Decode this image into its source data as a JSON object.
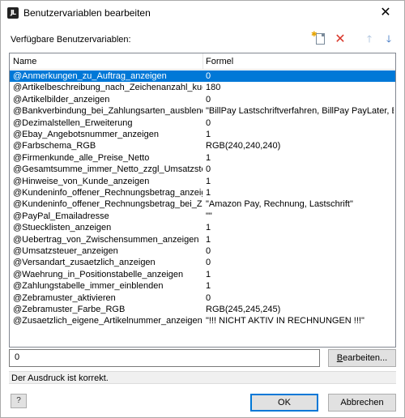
{
  "window": {
    "title": "Benutzervariablen bearbeiten",
    "app_icon_text": "JL",
    "close_glyph": "✕"
  },
  "toolbar": {
    "label": "Verfügbare Benutzervariablen:",
    "icons": [
      "new-variable-icon",
      "delete-icon",
      "move-up-icon",
      "move-down-icon"
    ]
  },
  "table": {
    "headers": {
      "name": "Name",
      "formula": "Formel"
    },
    "selected_index": 0,
    "rows": [
      {
        "name": "@Anmerkungen_zu_Auftrag_anzeigen",
        "formula": "0"
      },
      {
        "name": "@Artikelbeschreibung_nach_Zeichenanzahl_kuerzen",
        "formula": "180"
      },
      {
        "name": "@Artikelbilder_anzeigen",
        "formula": "0"
      },
      {
        "name": "@Bankverbindung_bei_Zahlungsarten_ausblenden",
        "formula": "\"BillPay Lastschriftverfahren, BillPay PayLater, BillPay F"
      },
      {
        "name": "@Dezimalstellen_Erweiterung",
        "formula": "0"
      },
      {
        "name": "@Ebay_Angebotsnummer_anzeigen",
        "formula": "1"
      },
      {
        "name": "@Farbschema_RGB",
        "formula": "RGB(240,240,240)"
      },
      {
        "name": "@Firmenkunde_alle_Preise_Netto",
        "formula": "1"
      },
      {
        "name": "@Gesamtsumme_immer_Netto_zzgl_Umsatzsteuer",
        "formula": "0"
      },
      {
        "name": "@Hinweise_von_Kunde_anzeigen",
        "formula": "1"
      },
      {
        "name": "@Kundeninfo_offener_Rechnungsbetrag_anzeigen",
        "formula": "1"
      },
      {
        "name": "@Kundeninfo_offener_Rechnungsbetrag_bei_Zahlungs",
        "formula": "\"Amazon Pay, Rechnung, Lastschrift\""
      },
      {
        "name": "@PayPal_Emailadresse",
        "formula": "\"\""
      },
      {
        "name": "@Stuecklisten_anzeigen",
        "formula": "1"
      },
      {
        "name": "@Uebertrag_von_Zwischensummen_anzeigen",
        "formula": "1"
      },
      {
        "name": "@Umsatzsteuer_anzeigen",
        "formula": "0"
      },
      {
        "name": "@Versandart_zusaetzlich_anzeigen",
        "formula": "0"
      },
      {
        "name": "@Waehrung_in_Positionstabelle_anzeigen",
        "formula": "1"
      },
      {
        "name": "@Zahlungstabelle_immer_einblenden",
        "formula": "1"
      },
      {
        "name": "@Zebramuster_aktivieren",
        "formula": "0"
      },
      {
        "name": "@Zebramuster_Farbe_RGB",
        "formula": "RGB(245,245,245)"
      },
      {
        "name": "@Zusaetzlich_eigene_Artikelnummer_anzeigen",
        "formula": "\"!!! NICHT AKTIV IN RECHNUNGEN !!!\""
      }
    ]
  },
  "expression": {
    "value": "0",
    "edit_button": "Bearbeiten..."
  },
  "status": {
    "text": "Der Ausdruck ist korrekt."
  },
  "footer": {
    "help_glyph": "?",
    "ok": "OK",
    "cancel": "Abbrechen"
  },
  "colors": {
    "selection": "#0078d7",
    "delete_icon": "#d9372a",
    "arrow_down": "#1f5fb8",
    "arrow_up_disabled": "#9bb5d6"
  }
}
